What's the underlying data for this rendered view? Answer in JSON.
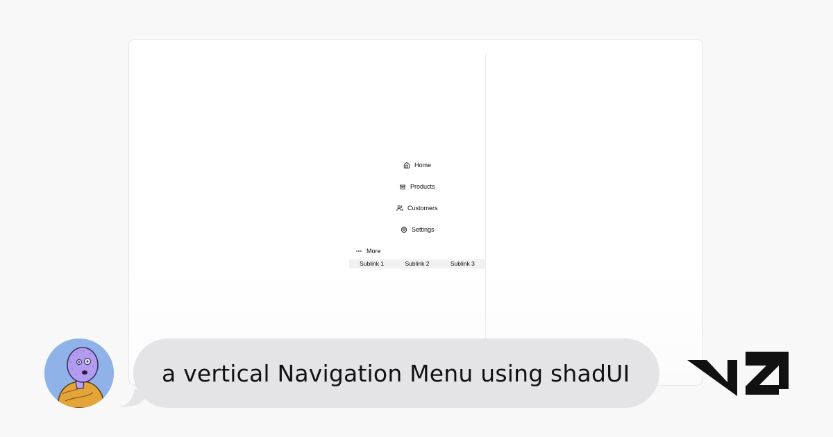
{
  "preview": {
    "nav": {
      "items": [
        {
          "label": "Home",
          "icon": "home-icon"
        },
        {
          "label": "Products",
          "icon": "package-icon"
        },
        {
          "label": "Customers",
          "icon": "users-icon"
        },
        {
          "label": "Settings",
          "icon": "gear-icon"
        }
      ],
      "more": {
        "label": "More",
        "icon": "more-horizontal-icon"
      },
      "sublinks": [
        "Sublink 1",
        "Sublink 2",
        "Sublink 3"
      ]
    }
  },
  "chat": {
    "prompt": "a vertical Navigation Menu using shadUI",
    "avatar_icon": "user-avatar-icon"
  },
  "brand": {
    "logo": "v0-logo-icon"
  },
  "colors": {
    "background": "#f8f8f8",
    "bubble": "#e4e4e7",
    "avatar_bg": "#8fb3e8",
    "text": "#0a0a0a"
  }
}
